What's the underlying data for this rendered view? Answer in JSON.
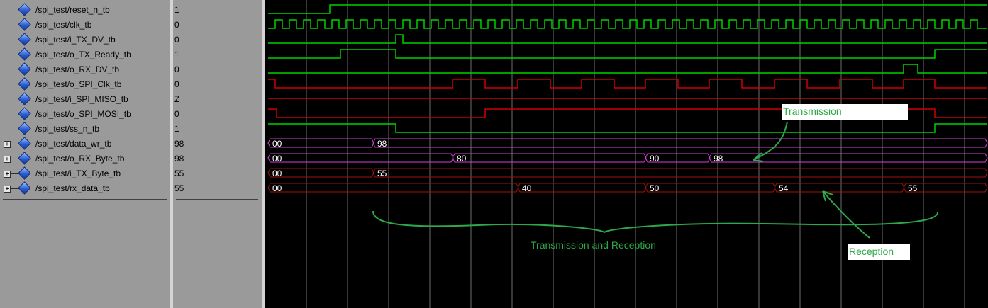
{
  "signals": [
    {
      "name": "/spi_test/reset_n_tb",
      "value": "1",
      "bus": false
    },
    {
      "name": "/spi_test/clk_tb",
      "value": "0",
      "bus": false
    },
    {
      "name": "/spi_test/i_TX_DV_tb",
      "value": "0",
      "bus": false
    },
    {
      "name": "/spi_test/o_TX_Ready_tb",
      "value": "1",
      "bus": false
    },
    {
      "name": "/spi_test/o_RX_DV_tb",
      "value": "0",
      "bus": false
    },
    {
      "name": "/spi_test/o_SPI_Clk_tb",
      "value": "0",
      "bus": false
    },
    {
      "name": "/spi_test/i_SPI_MISO_tb",
      "value": "Z",
      "bus": false
    },
    {
      "name": "/spi_test/o_SPI_MOSI_tb",
      "value": "0",
      "bus": false
    },
    {
      "name": "/spi_test/ss_n_tb",
      "value": "1",
      "bus": false
    },
    {
      "name": "/spi_test/data_wr_tb",
      "value": "98",
      "bus": true
    },
    {
      "name": "/spi_test/o_RX_Byte_tb",
      "value": "98",
      "bus": true
    },
    {
      "name": "/spi_test/i_TX_Byte_tb",
      "value": "55",
      "bus": true
    },
    {
      "name": "/spi_test/rx_data_tb",
      "value": "55",
      "bus": true
    }
  ],
  "bus_waves": {
    "data_wr": [
      "00",
      "98"
    ],
    "o_RX_Byte": [
      "00",
      "80",
      "90",
      "98"
    ],
    "i_TX_Byte": [
      "00",
      "55"
    ],
    "rx_data": [
      "00",
      "40",
      "50",
      "54",
      "55"
    ]
  },
  "annotations": {
    "transmission": "Transmission",
    "reception": "Reception",
    "transmission_and_reception": "Transmission and Reception"
  },
  "colors": {
    "green": "#00d100",
    "red": "#d10000",
    "magenta": "#d040d0",
    "darkred": "#a01010",
    "grid": "#6e6e6e",
    "annotation": "#2ea84a"
  }
}
